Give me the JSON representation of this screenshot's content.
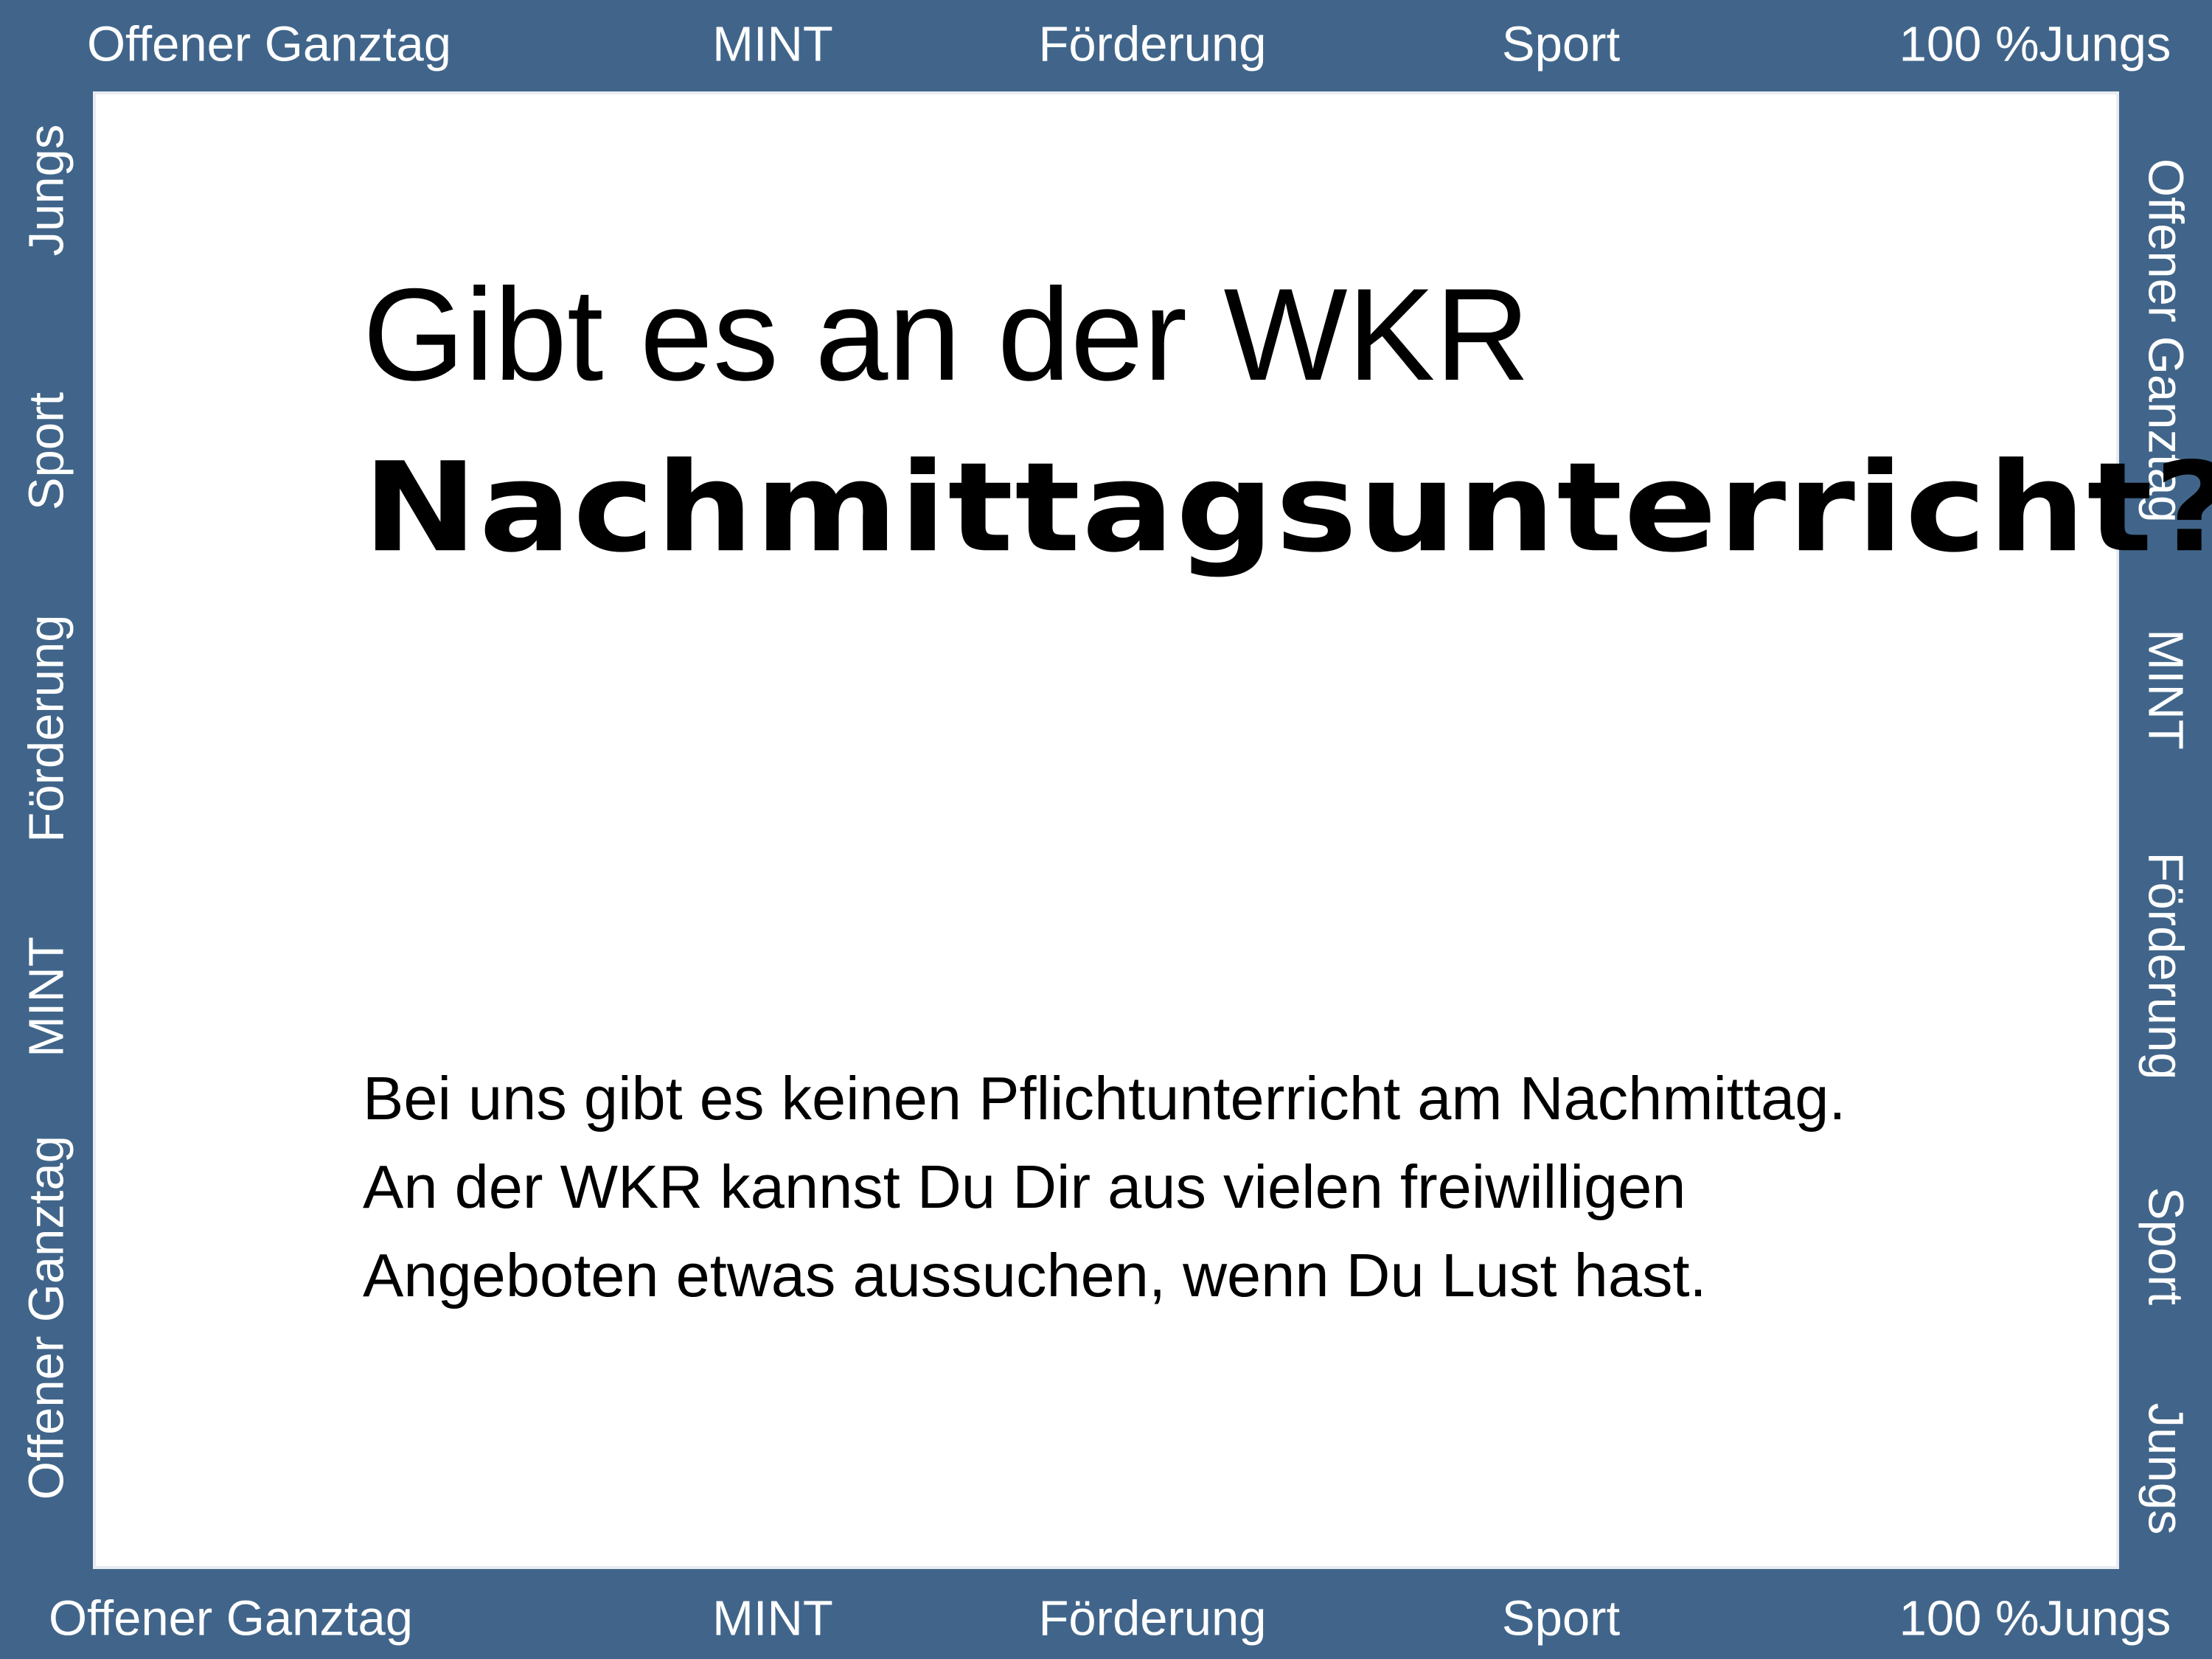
{
  "frame": {
    "top": [
      "Offener Ganztag",
      "MINT",
      "Förderung",
      "Sport",
      "100 %Jungs"
    ],
    "bottom": [
      "Offener Ganztag",
      "MINT",
      "Förderung",
      "Sport",
      "100 %Jungs"
    ],
    "left": [
      "Jungs",
      "Sport",
      "Förderung",
      "MINT",
      "Offener Ganztag"
    ],
    "right": [
      "Offener Ganztag",
      "MINT",
      "Förderung",
      "Sport",
      "Jungs"
    ]
  },
  "title": {
    "line1": "Gibt es an der WKR",
    "line2": "Nachmittagsunterricht?"
  },
  "body": {
    "line1": "Bei uns gibt es keinen Pflichtunterricht am Nachmittag.",
    "line2": "An der WKR kannst Du Dir aus vielen freiwilligen",
    "line3": "Angeboten etwas aussuchen, wenn Du Lust hast."
  },
  "colors": {
    "frame": "#41658a",
    "text_on_frame": "#ffffff",
    "content_bg": "#ffffff"
  }
}
